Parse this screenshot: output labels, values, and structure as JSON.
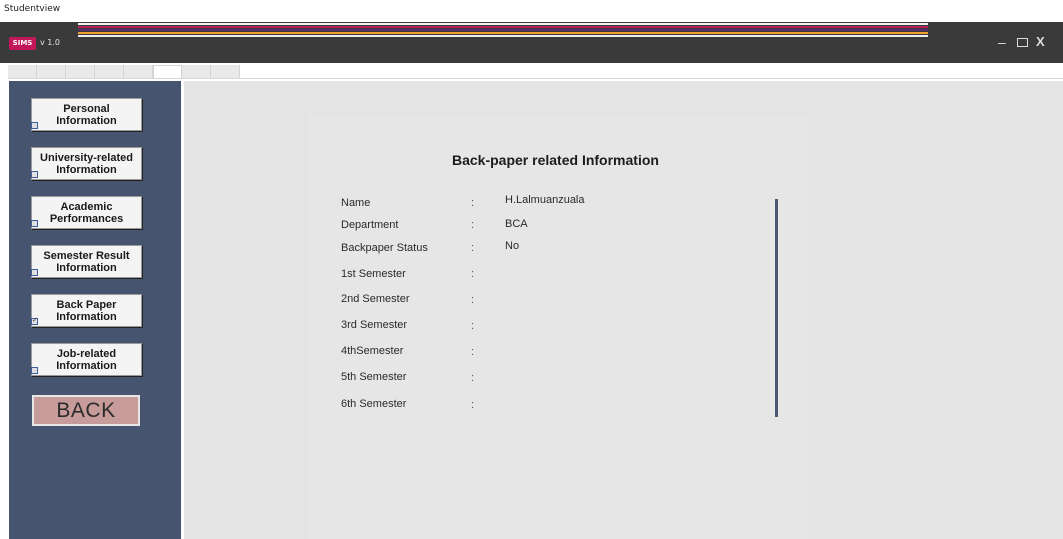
{
  "window": {
    "caption": "Studentview"
  },
  "titlebar": {
    "logo": "SIMS",
    "version": "v 1.0",
    "stripe_colors": [
      "#f1f1f1",
      "#b71c5c",
      "#5a2a6a",
      "#f0a030",
      "#eeeeee"
    ],
    "controls": {
      "minimize": "–",
      "close": "X"
    }
  },
  "tabs": {
    "count": 8,
    "active_index": 5
  },
  "sidebar": {
    "background": "#47546f",
    "items": [
      {
        "line1": "Personal",
        "line2": "Information",
        "checked": false
      },
      {
        "line1": "University-related",
        "line2": "Information",
        "checked": false
      },
      {
        "line1": "Academic",
        "line2": "Performances",
        "checked": false
      },
      {
        "line1": "Semester Result",
        "line2": "Information",
        "checked": false
      },
      {
        "line1": "Back Paper",
        "line2": "Information",
        "checked": true
      },
      {
        "line1": "Job-related",
        "line2": "Information",
        "checked": false
      }
    ],
    "back_label": "BACK"
  },
  "main": {
    "title": "Back-paper related Information",
    "fields": [
      {
        "label": "Name",
        "colon": ":",
        "value": "H.Lalmuanzuala"
      },
      {
        "label": "Department",
        "colon": ":",
        "value": "BCA"
      },
      {
        "label": "Backpaper Status",
        "colon": ":",
        "value": "No"
      },
      {
        "label": "1st Semester",
        "colon": ":",
        "value": ""
      },
      {
        "label": "2nd Semester",
        "colon": ":",
        "value": ""
      },
      {
        "label": "3rd Semester",
        "colon": ":",
        "value": ""
      },
      {
        "label": "4thSemester",
        "colon": ":",
        "value": ""
      },
      {
        "label": "5th Semester",
        "colon": ":",
        "value": ""
      },
      {
        "label": "6th Semester",
        "colon": ":",
        "value": ""
      }
    ]
  }
}
